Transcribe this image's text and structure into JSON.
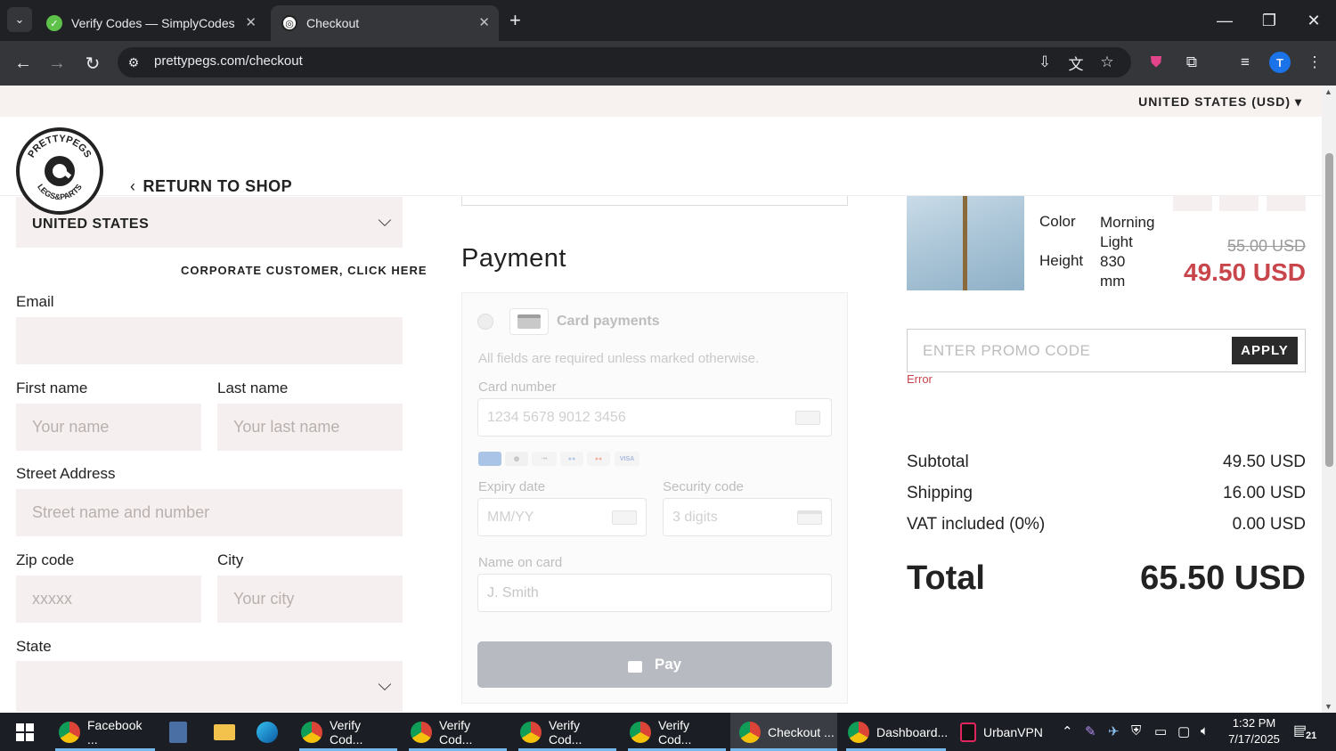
{
  "browser": {
    "tabs": [
      {
        "title": "Verify Codes — SimplyCodes",
        "active": false
      },
      {
        "title": "Checkout",
        "active": true
      }
    ],
    "url": "prettypegs.com/checkout",
    "profile_initial": "T"
  },
  "site": {
    "currency_selector": "UNITED STATES (USD)",
    "logo_text_top": "PRETTYPEGS",
    "logo_text_bottom": "LEGS&PARTS",
    "return_link": "RETURN TO SHOP"
  },
  "shipping_form": {
    "country": "UNITED STATES",
    "corporate_link": "CORPORATE CUSTOMER, CLICK HERE",
    "email_label": "Email",
    "email_value": "",
    "first_name_label": "First name",
    "first_name_placeholder": "Your name",
    "last_name_label": "Last name",
    "last_name_placeholder": "Your last name",
    "street_label": "Street Address",
    "street_placeholder": "Street name and number",
    "zip_label": "Zip code",
    "zip_placeholder": "xxxxx",
    "city_label": "City",
    "city_placeholder": "Your city",
    "state_label": "State",
    "state_value": ""
  },
  "payment": {
    "title": "Payment",
    "method_label": "Card payments",
    "required_note": "All fields are required unless marked otherwise.",
    "card_number_label": "Card number",
    "card_number_placeholder": "1234 5678 9012 3456",
    "brands": [
      "AMEX",
      "DC",
      "DISCOVER",
      "MAESTRO",
      "MC",
      "VISA"
    ],
    "expiry_label": "Expiry date",
    "expiry_placeholder": "MM/YY",
    "cvc_label": "Security code",
    "cvc_placeholder": "3 digits",
    "name_label": "Name on card",
    "name_placeholder": "J. Smith",
    "pay_button": "Pay"
  },
  "order": {
    "attrs": [
      {
        "name": "Color",
        "value": "Morning Light"
      },
      {
        "name": "Height",
        "value": "830 mm"
      }
    ],
    "old_price": "55.00 USD",
    "new_price": "49.50 USD",
    "promo_placeholder": "ENTER PROMO CODE",
    "apply_button": "APPLY",
    "promo_error": "Error",
    "subtotal_label": "Subtotal",
    "subtotal_value": "49.50 USD",
    "shipping_label": "Shipping",
    "shipping_value": "16.00 USD",
    "vat_label": "VAT included (0%)",
    "vat_value": "0.00 USD",
    "total_label": "Total",
    "total_value": "65.50 USD"
  },
  "taskbar": {
    "items": [
      {
        "label": "Facebook ...",
        "active": false
      },
      {
        "label": "Verify Cod...",
        "active": false
      },
      {
        "label": "Verify Cod...",
        "active": false
      },
      {
        "label": "Verify Cod...",
        "active": false
      },
      {
        "label": "Verify Cod...",
        "active": false
      },
      {
        "label": "Checkout ...",
        "active": true
      },
      {
        "label": "Dashboard...",
        "active": false
      },
      {
        "label": "UrbanVPN",
        "active": false
      }
    ],
    "time": "1:32 PM",
    "date": "7/17/2025",
    "notification_count": "21"
  },
  "colors": {
    "accent_red": "#c8454b",
    "pay_button": "#b7bbc1",
    "field_bg": "#f5f0ef"
  }
}
